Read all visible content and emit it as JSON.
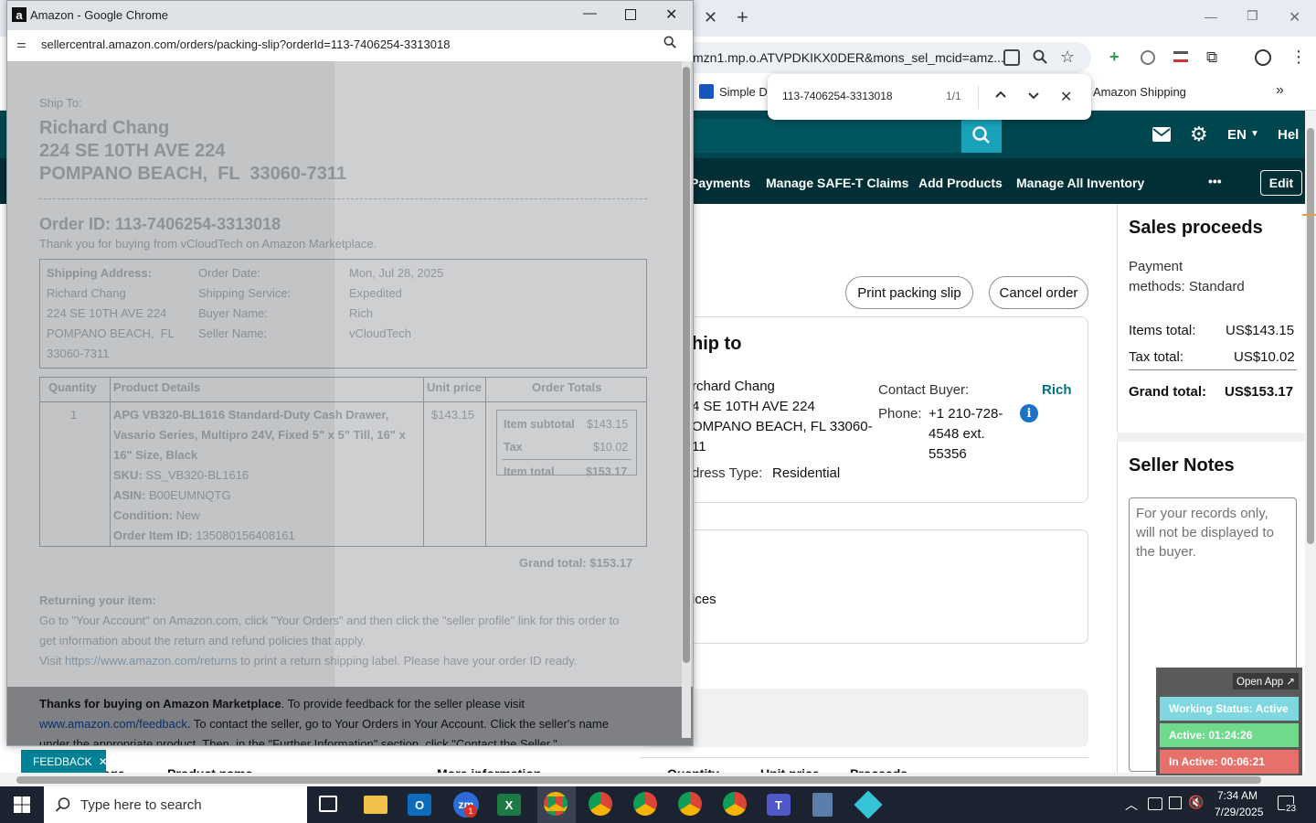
{
  "browser": {
    "url_fragment": "mzn1.mp.o.ATVPDKIKX0DER&mons_sel_mcid=amz...",
    "bookmarks": [
      "Simple Da",
      "Amazon Shipping"
    ],
    "tab_close": "✕",
    "new_tab": "+"
  },
  "findbar": {
    "query": "113-7406254-3313018",
    "count": "1/1"
  },
  "amazon": {
    "header_right": {
      "lang": "EN",
      "help": "Hel"
    },
    "nav": [
      "Payments",
      "Manage SAFE-T Claims",
      "Add Products",
      "Manage All Inventory"
    ],
    "nav_more": "•••",
    "nav_edit": "Edit",
    "buttons": {
      "print_packing_slip": "Print packing slip",
      "cancel_order": "Cancel order"
    },
    "ship_to": {
      "heading": "hip to",
      "lines": [
        "rchard Chang",
        "4 SE 10TH AVE 224",
        "OMPANO BEACH, FL 33060-",
        "11"
      ],
      "address_type_label": "dress Type:",
      "address_type": "Residential",
      "contact_label": "Contact Buyer:",
      "contact_name": "Rich",
      "phone_label": "Phone:",
      "phone_lines": [
        "+1 210-728-",
        "4548 ext.",
        "55356"
      ]
    },
    "card2_text": "ices",
    "table_headers_partial": [
      "mage",
      "Product name",
      "More information",
      "Quantity",
      "Unit price",
      "Proceeds"
    ],
    "sales": {
      "heading": "Sales proceeds",
      "payment_methods_lines": [
        "Payment",
        "methods: Standard"
      ],
      "items_total_label": "Items total:",
      "items_total": "US$143.15",
      "tax_total_label": "Tax total:",
      "tax_total": "US$10.02",
      "grand_total_label": "Grand total:",
      "grand_total": "US$153.17"
    },
    "seller_notes": {
      "heading": "Seller Notes",
      "placeholder_lines": [
        "For your records only,",
        "will not be displayed to",
        "the buyer."
      ]
    },
    "feedback": "FEEDBACK"
  },
  "popup": {
    "title": "Amazon - Google Chrome",
    "url": "sellercentral.amazon.com/orders/packing-slip?orderId=113-7406254-3313018",
    "slip": {
      "ship_to_label": "Ship To:",
      "ship_to_lines": [
        "Richard Chang",
        "224 SE 10TH AVE 224",
        "POMPANO BEACH,  FL  33060-7311"
      ],
      "order_id": "Order ID: 113-7406254-3313018",
      "thank_you": "Thank you for buying from vCloudTech on Amazon Marketplace.",
      "shipping_address_label": "Shipping Address:",
      "address_lines": [
        "Richard Chang",
        "224 SE 10TH AVE 224",
        "POMPANO BEACH,  FL",
        "33060-7311"
      ],
      "meta_labels": [
        "Order Date:",
        "Shipping Service:",
        "Buyer Name:",
        "Seller Name:"
      ],
      "meta_values": [
        "Mon, Jul 28, 2025",
        "Expedited",
        "Rich",
        "vCloudTech"
      ],
      "col_headers": [
        "Quantity",
        "Product Details",
        "Unit price",
        "Order Totals"
      ],
      "quantity": "1",
      "product_lines": [
        "APG VB320-BL1616 Standard-Duty Cash Drawer,",
        "Vasario Series, Multipro 24V, Fixed 5\" x 5\" Till, 16\" x",
        "16\" Size, Black"
      ],
      "sku_label": "SKU:",
      "sku": "SS_VB320-BL1616",
      "asin_label": "ASIN:",
      "asin": "B00EUMNQTG",
      "condition_label": "Condition:",
      "condition": "New",
      "order_item_label": "Order Item ID:",
      "order_item_id": "135080156408161",
      "unit_price": "$143.15",
      "item_subtotal_label": "Item subtotal",
      "item_subtotal": "$143.15",
      "tax_label": "Tax",
      "tax": "$10.02",
      "item_total_label": "Item total",
      "item_total": "$153.17",
      "grand_total": "Grand total: $153.17",
      "returning_heading": "Returning your item:",
      "returning_lines": [
        "Go to \"Your Account\" on Amazon.com, click \"Your Orders\" and then click the \"seller profile\" link for this order to",
        "get information about the return and refund policies that apply."
      ],
      "visit_prefix": "Visit ",
      "returns_link": "https://www.amazon.com/returns",
      "visit_suffix": " to print a return shipping label. Please have your order ID ready.",
      "thanks_bold": "Thanks for buying on Amazon Marketplace",
      "thanks_rest": ". To provide feedback for the seller please visit",
      "feedback_link": "www.amazon.com/feedback",
      "feedback_rest": ". To contact the seller, go to Your Orders in Your Account. Click the seller's name",
      "last_line": "under the appropriate product. Then, in the \"Further Information\" section, click \"Contact the Seller.\""
    }
  },
  "widget": {
    "open_app": "Open App ↗",
    "working_status": "Working Status: Active",
    "active": "Active: 01:24:26",
    "inactive": "In Active: 00:06:21",
    "colors": {
      "working": "#7fd8df",
      "active": "#6fd98c",
      "inactive": "#e8706b"
    }
  },
  "taskbar": {
    "search_placeholder": "Type here to search",
    "time": "7:34 AM",
    "date": "7/29/2025",
    "notification_count": "23"
  }
}
